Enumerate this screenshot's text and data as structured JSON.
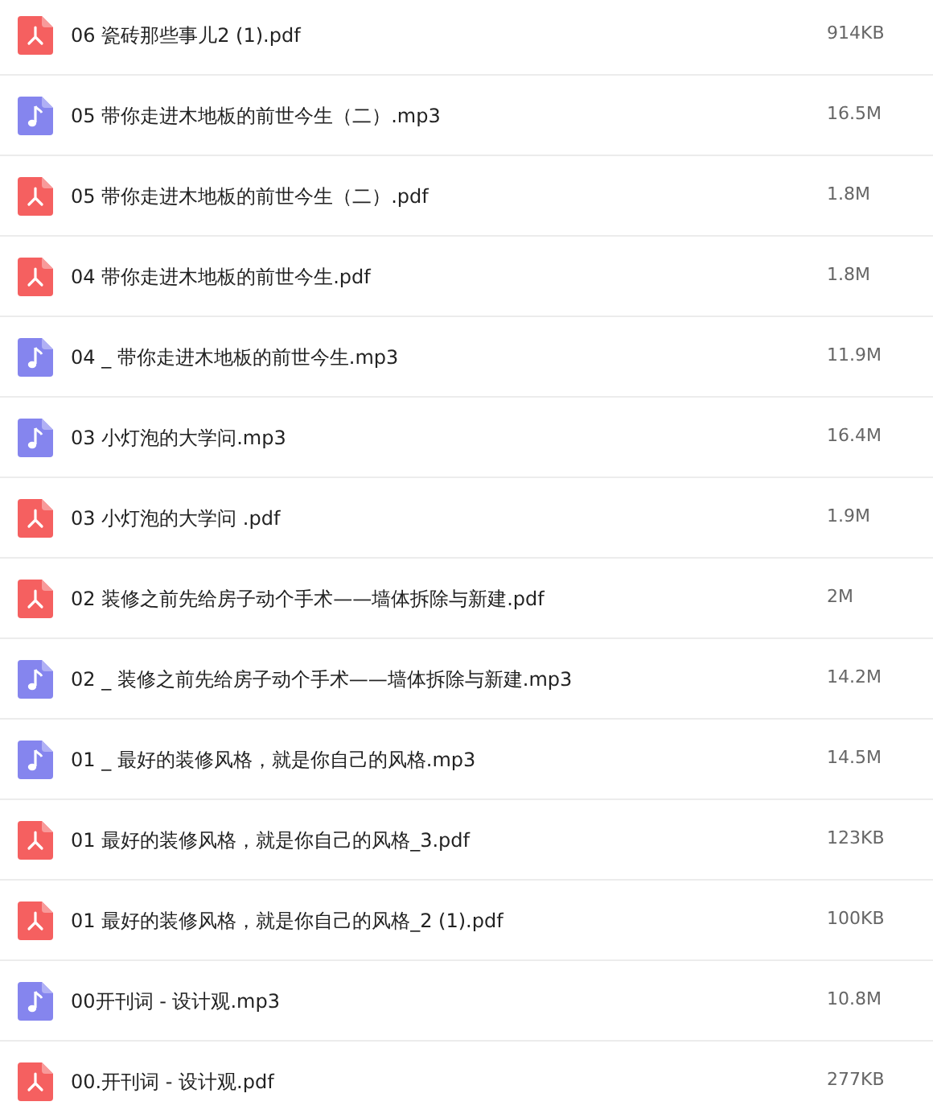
{
  "files": [
    {
      "kind": "pdf",
      "name": "06 瓷砖那些事儿2 (1).pdf",
      "size": "914KB"
    },
    {
      "kind": "audio",
      "name": "05 带你走进木地板的前世今生（二）.mp3",
      "size": "16.5M"
    },
    {
      "kind": "pdf",
      "name": "05 带你走进木地板的前世今生（二）.pdf",
      "size": "1.8M"
    },
    {
      "kind": "pdf",
      "name": "04 带你走进木地板的前世今生.pdf",
      "size": "1.8M"
    },
    {
      "kind": "audio",
      "name": "04 _ 带你走进木地板的前世今生.mp3",
      "size": "11.9M"
    },
    {
      "kind": "audio",
      "name": "03 小灯泡的大学问.mp3",
      "size": "16.4M"
    },
    {
      "kind": "pdf",
      "name": "03 小灯泡的大学问 .pdf",
      "size": "1.9M"
    },
    {
      "kind": "pdf",
      "name": "02 装修之前先给房子动个手术——墙体拆除与新建.pdf",
      "size": "2M"
    },
    {
      "kind": "audio",
      "name": "02 _ 装修之前先给房子动个手术——墙体拆除与新建.mp3",
      "size": "14.2M"
    },
    {
      "kind": "audio",
      "name": "01 _ 最好的装修风格，就是你自己的风格.mp3",
      "size": "14.5M"
    },
    {
      "kind": "pdf",
      "name": "01 最好的装修风格，就是你自己的风格_3.pdf",
      "size": "123KB"
    },
    {
      "kind": "pdf",
      "name": "01 最好的装修风格，就是你自己的风格_2 (1).pdf",
      "size": "100KB"
    },
    {
      "kind": "audio",
      "name": "00开刊词 - 设计观.mp3",
      "size": "10.8M"
    },
    {
      "kind": "pdf",
      "name": "00.开刊词 - 设计观.pdf",
      "size": "277KB"
    }
  ]
}
